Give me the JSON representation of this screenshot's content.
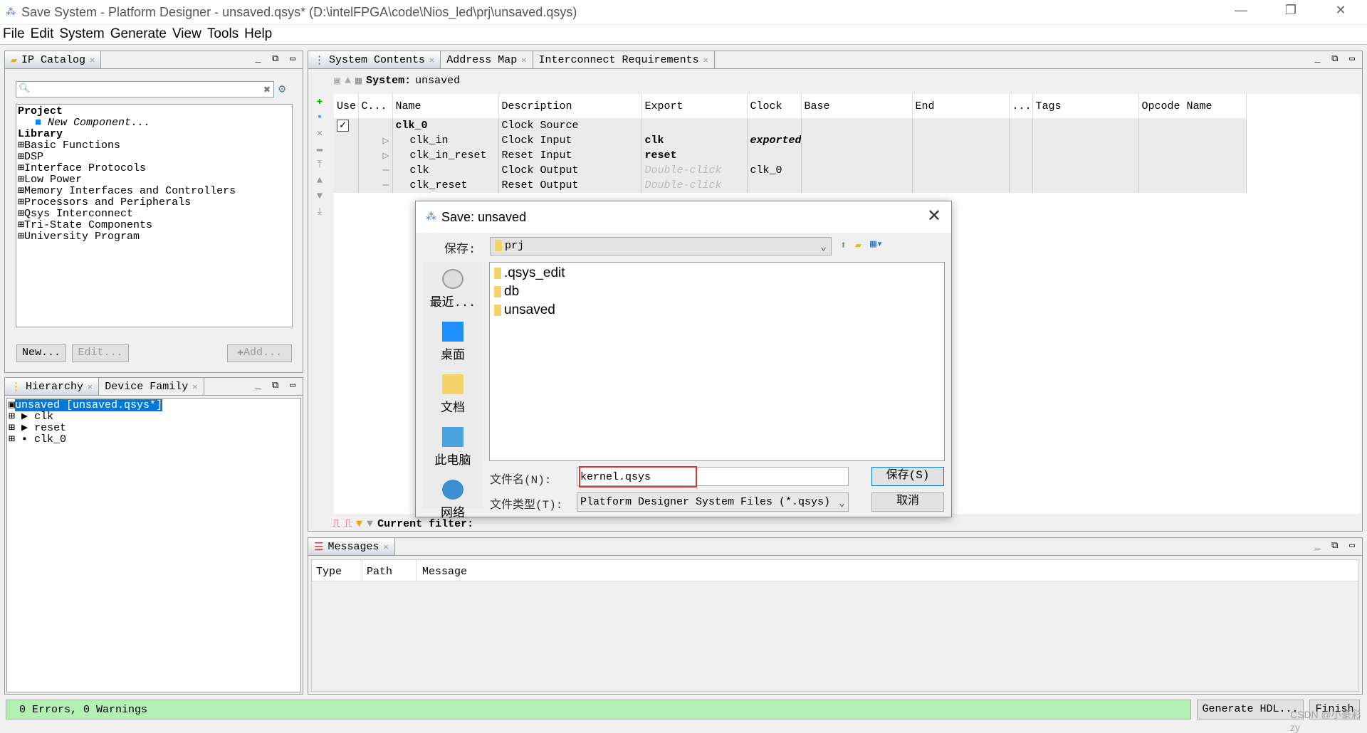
{
  "window": {
    "title": "Save System - Platform Designer - unsaved.qsys* (D:\\intelFPGA\\code\\Nios_led\\prj\\unsaved.qsys)",
    "minimize": "—",
    "restore": "❐",
    "close": "✕"
  },
  "menu": [
    "File",
    "Edit",
    "System",
    "Generate",
    "View",
    "Tools",
    "Help"
  ],
  "ip_catalog": {
    "tab": "IP Catalog",
    "search_value": "",
    "project_label": "Project",
    "new_component": "New Component...",
    "library_label": "Library",
    "items": [
      "Basic Functions",
      "DSP",
      "Interface Protocols",
      "Low Power",
      "Memory Interfaces and Controllers",
      "Processors and Peripherals",
      "Qsys Interconnect",
      "Tri-State Components",
      "University Program"
    ],
    "buttons": {
      "new": "New...",
      "edit": "Edit...",
      "add": "Add..."
    }
  },
  "hierarchy": {
    "tabs": [
      "Hierarchy",
      "Device Family"
    ],
    "root": "unsaved [unsaved.qsys*]",
    "items": [
      "clk",
      "reset",
      "clk_0"
    ]
  },
  "system": {
    "tabs": [
      "System Contents",
      "Address Map",
      "Interconnect Requirements"
    ],
    "system_label": "System:",
    "system_name": "unsaved",
    "columns": [
      "Use",
      "C...",
      "Name",
      "Description",
      "Export",
      "Clock",
      "Base",
      "End",
      "...",
      "Tags",
      "Opcode Name"
    ],
    "rows": [
      {
        "use": true,
        "name": "clk_0",
        "desc": "Clock Source",
        "export": "",
        "clock": "",
        "bold": true
      },
      {
        "name": "clk_in",
        "desc": "Clock Input",
        "export": "clk",
        "clock": "exported"
      },
      {
        "name": "clk_in_reset",
        "desc": "Reset Input",
        "export": "reset",
        "clock": ""
      },
      {
        "name": "clk",
        "desc": "Clock Output",
        "export": "Double-click",
        "clock": "clk_0"
      },
      {
        "name": "clk_reset",
        "desc": "Reset Output",
        "export": "Double-click",
        "clock": ""
      }
    ],
    "filter_label": "Current filter:"
  },
  "messages": {
    "tab": "Messages",
    "columns": [
      "Type",
      "Path",
      "Message"
    ]
  },
  "status": {
    "text": "0 Errors, 0 Warnings",
    "generate": "Generate HDL...",
    "finish": "Finish",
    "watermark": "CSDN @小豪彩zy"
  },
  "dialog": {
    "title": "Save: unsaved",
    "save_in_label": "保存:",
    "save_in_value": "prj",
    "places": [
      "最近...",
      "桌面",
      "文档",
      "此电脑",
      "网络"
    ],
    "files": [
      ".qsys_edit",
      "db",
      "unsaved"
    ],
    "filename_label": "文件名(N):",
    "filename_value": "kernel.qsys",
    "filetype_label": "文件类型(T):",
    "filetype_value": "Platform Designer System Files (*.qsys)",
    "save_button": "保存(S)",
    "cancel_button": "取消"
  },
  "colors": {
    "selection": "#0078d7",
    "status_green": "#b3f0b3",
    "highlight_box": "#e53030"
  }
}
